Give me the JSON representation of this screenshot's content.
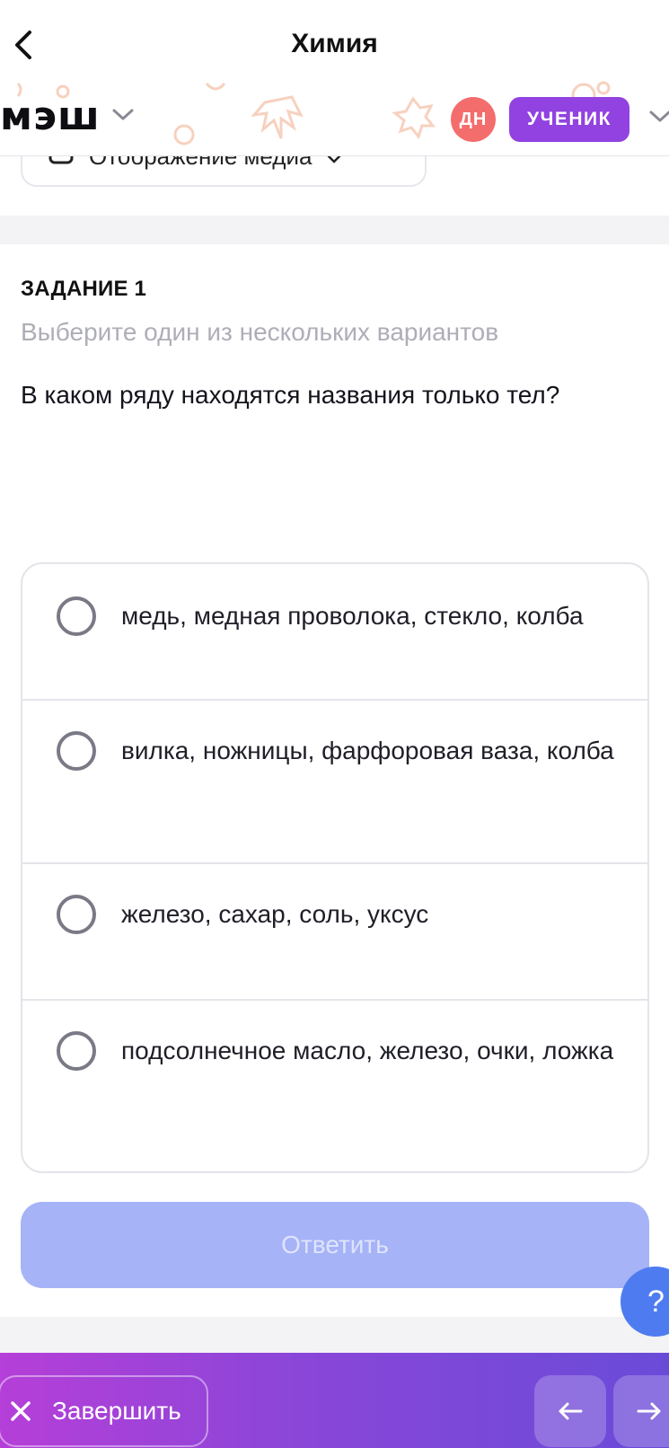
{
  "header": {
    "title": "Химия",
    "back_icon": "chevron-left-icon"
  },
  "brand": {
    "logo_text": "мэш",
    "avatar_initials": "ДН",
    "role_label": "УЧЕНИК",
    "avatar_color": "#f46d6d",
    "role_color": "#9242e0"
  },
  "media_dropdown": {
    "label": "Отображение медиа"
  },
  "task": {
    "label": "ЗАДАНИЕ 1",
    "hint": "Выберите один из нескольких вариантов",
    "question": "В каком ряду находятся названия только тел?",
    "options": [
      {
        "text": "медь, медная проволока, стекло, колба",
        "selected": false
      },
      {
        "text": "вилка, ножницы, фарфоровая ваза, колба",
        "selected": false
      },
      {
        "text": "железо, сахар, соль, уксус",
        "selected": false
      },
      {
        "text": "подсолнечное масло, железо, очки, ложка",
        "selected": false
      }
    ],
    "answer_button": "Ответить",
    "answer_color": "#a6b3f7"
  },
  "help": {
    "label": "?"
  },
  "footer": {
    "finish_label": "Завершить",
    "finish_icon": "close-icon",
    "prev_icon": "arrow-left-icon",
    "next_icon": "arrow-right-icon"
  }
}
